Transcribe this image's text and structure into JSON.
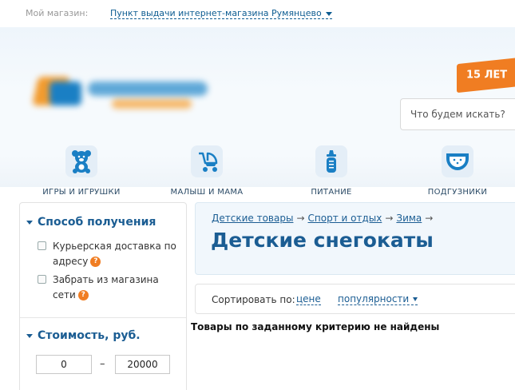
{
  "store": {
    "label": "Мой магазин:",
    "value": "Пункт выдачи интернет-магазина Румянцево"
  },
  "ribbon": {
    "text": "15 ЛЕТ"
  },
  "search": {
    "placeholder": "Что будем искать?"
  },
  "categories": [
    {
      "label": "ИГРЫ И ИГРУШКИ",
      "icon": "teddy-bear-icon"
    },
    {
      "label": "МАЛЫШ И МАМА",
      "icon": "stroller-icon"
    },
    {
      "label": "ПИТАНИЕ",
      "icon": "baby-bottle-icon"
    },
    {
      "label": "ПОДГУЗНИКИ",
      "icon": "diaper-icon"
    }
  ],
  "filters": {
    "delivery": {
      "title": "Способ получения",
      "options": [
        {
          "label": "Курьерская доставка по адресу",
          "checked": false
        },
        {
          "label": "Забрать из магазина сети",
          "checked": false
        }
      ]
    },
    "price": {
      "title": "Стоимость, руб.",
      "min": "0",
      "max": "20000",
      "dash": "–"
    }
  },
  "breadcrumbs": [
    "Детские товары",
    "Спорт и отдых",
    "Зима"
  ],
  "breadcrumb_separator": "→",
  "page_title": "Детские снегокаты",
  "sort": {
    "label": "Сортировать по:",
    "options": [
      "цене",
      "популярности"
    ]
  },
  "empty_message": "Товары по заданному критерию не найдены",
  "colors": {
    "accent": "#1b5d93",
    "orange": "#f07d22",
    "icon_bg": "#e4eef7"
  }
}
